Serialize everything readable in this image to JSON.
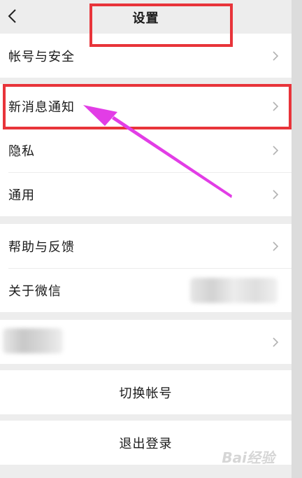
{
  "header": {
    "title": "设置",
    "back_icon": "chevron-left-icon"
  },
  "groups": {
    "account": {
      "label": "帐号与安全"
    },
    "notifications": {
      "label": "新消息通知"
    },
    "privacy": {
      "label": "隐私"
    },
    "general": {
      "label": "通用"
    },
    "help": {
      "label": "帮助与反馈"
    },
    "about": {
      "label": "关于微信"
    }
  },
  "actions": {
    "switch_account": "切换帐号",
    "logout": "退出登录"
  },
  "annotations": {
    "box_color": "#e8343a",
    "arrow_color": "#e23de6"
  },
  "watermark": "Bai经验"
}
